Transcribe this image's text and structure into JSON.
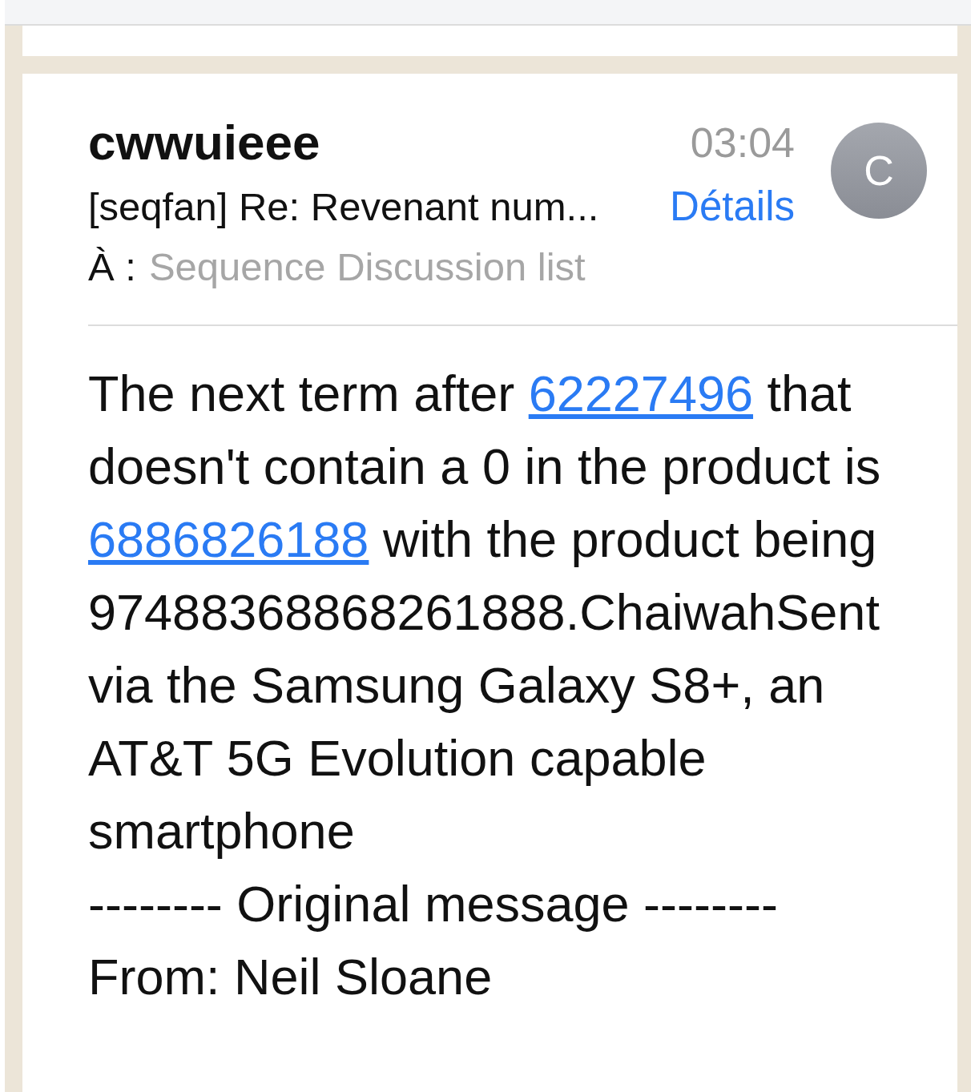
{
  "message": {
    "sender": "cwwuieee",
    "time": "03:04",
    "subject": "[seqfan] Re: Revenant num...",
    "details_link": "Détails",
    "avatar_letter": "C",
    "to_label": "À :",
    "to": "Sequence Discussion list"
  },
  "body": {
    "paragraph": [
      {
        "text": "The next term after ",
        "link": false
      },
      {
        "text": "62227496",
        "link": true
      },
      {
        "text": " that doesn't contain a 0 in the product is ",
        "link": false
      },
      {
        "text": "6886826188",
        "link": true
      },
      {
        "text": " with the product being 97488368868261888.ChaiwahSent via the Samsung Galaxy S8+, an AT&T 5G Evolution capable smartphone",
        "link": false
      }
    ],
    "lines": [
      "-------- Original message --------",
      "From: Neil Sloane"
    ]
  }
}
